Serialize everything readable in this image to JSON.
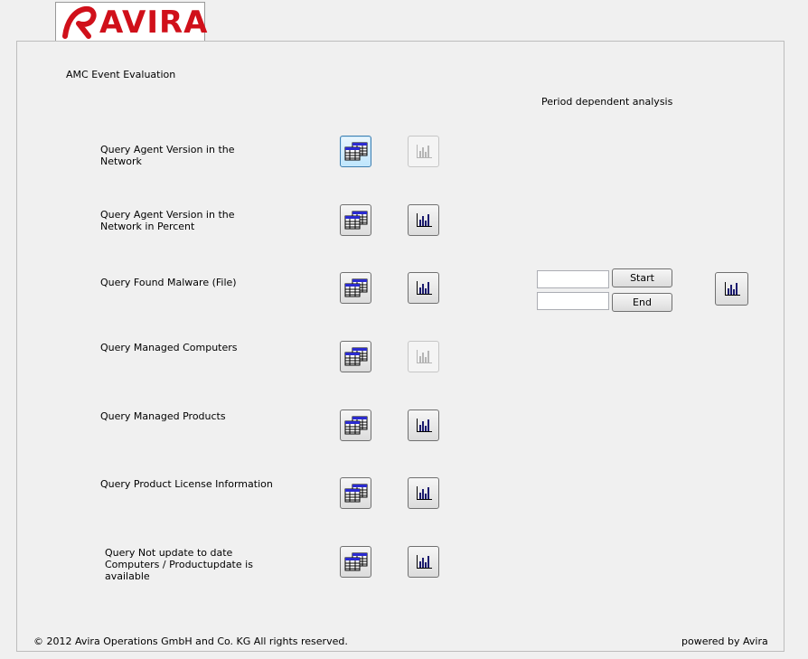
{
  "brand": {
    "logo_text": "AVIRA",
    "logo_color": "#d0101a"
  },
  "header": {
    "title": "AMC Event Evaluation",
    "period_label": "Period dependent analysis"
  },
  "queries": [
    {
      "label": "Query Agent Version in the\nNetwork",
      "table_icon": "table-report-icon",
      "chart_icon": "bar-chart-icon",
      "chart_enabled": false,
      "table_focused": true
    },
    {
      "label": "Query Agent Version in the\nNetwork in Percent",
      "table_icon": "table-report-icon",
      "chart_icon": "bar-chart-icon",
      "chart_enabled": true
    },
    {
      "label": "Query Found Malware (File)",
      "table_icon": "table-report-icon",
      "chart_icon": "bar-chart-icon",
      "chart_enabled": true
    },
    {
      "label": "Query Managed Computers",
      "table_icon": "table-report-icon",
      "chart_icon": "bar-chart-icon",
      "chart_enabled": false
    },
    {
      "label": "Query Managed Products",
      "table_icon": "table-report-icon",
      "chart_icon": "bar-chart-icon",
      "chart_enabled": true
    },
    {
      "label": "Query Product License Information",
      "table_icon": "table-report-icon",
      "chart_icon": "bar-chart-icon",
      "chart_enabled": true
    },
    {
      "label": "Query Not update to date\nComputers / Productupdate is\navailable",
      "table_icon": "table-report-icon",
      "chart_icon": "bar-chart-icon",
      "chart_enabled": true
    }
  ],
  "period": {
    "start_value": "",
    "end_value": "",
    "start_label": "Start",
    "end_label": "End",
    "chart_icon": "bar-chart-icon"
  },
  "footer": {
    "copyright": "© 2012 Avira Operations GmbH and Co. KG All rights reserved.",
    "powered": "powered by Avira"
  }
}
